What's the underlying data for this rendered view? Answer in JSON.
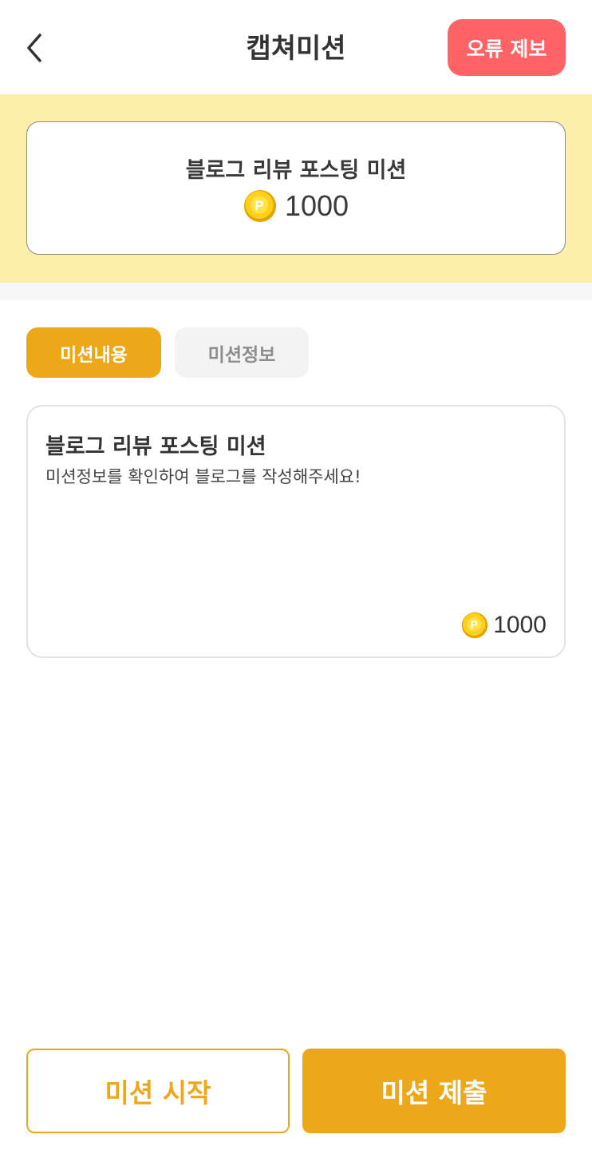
{
  "header": {
    "title": "캡쳐미션",
    "back_icon": "chevron-left-icon",
    "report_label": "오류 제보"
  },
  "summary": {
    "title": "블로그 리뷰 포스팅 미션",
    "reward_icon": "point-coin-icon",
    "reward": "1000"
  },
  "tabs": [
    {
      "label": "미션내용",
      "active": true
    },
    {
      "label": "미션정보",
      "active": false
    }
  ],
  "mission": {
    "title": "블로그 리뷰 포스팅 미션",
    "description": "미션정보를 확인하여 블로그를 작성해주세요!",
    "reward": "1000"
  },
  "actions": {
    "start_label": "미션 시작",
    "submit_label": "미션 제출"
  },
  "colors": {
    "accent": "#eda81a",
    "report": "#ff6366",
    "band": "#fdeeac"
  }
}
